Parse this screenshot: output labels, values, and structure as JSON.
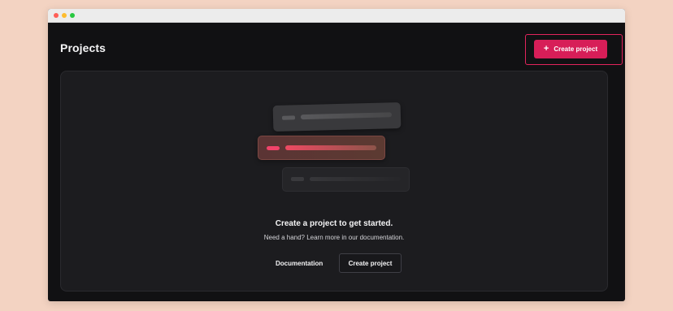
{
  "window_controls": [
    "close",
    "minimize",
    "maximize"
  ],
  "header": {
    "title": "Projects",
    "create_button": {
      "icon": "plus-icon",
      "label": "Create project"
    }
  },
  "empty_state": {
    "headline": "Create a project to get started.",
    "subtext": "Need a hand? Learn more in our documentation.",
    "documentation_link": "Documentation",
    "create_button": "Create project"
  },
  "colors": {
    "accent": "#d71e58",
    "highlight_border": "#e2245c",
    "background": "#f3d3c2",
    "panel": "#1c1c1f"
  }
}
